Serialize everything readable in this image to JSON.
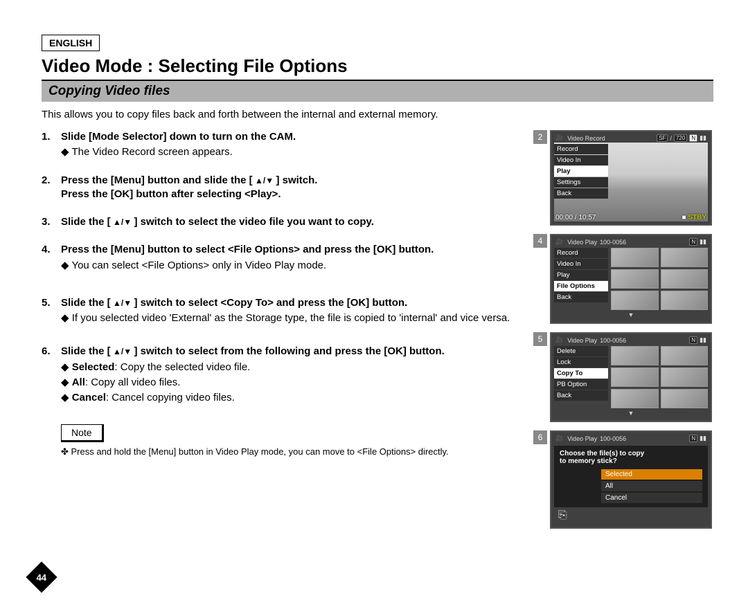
{
  "lang": "ENGLISH",
  "title": "Video Mode : Selecting File Options",
  "subtitle": "Copying Video files",
  "intro": "This allows you to copy files back and forth between the internal and external memory.",
  "steps": {
    "s1": {
      "num": "1.",
      "head": "Slide [Mode Selector] down to turn on the CAM.",
      "sub1": "The Video Record screen appears."
    },
    "s2": {
      "num": "2.",
      "head_a": "Press the [Menu] button and slide the [",
      "head_b": "] switch.",
      "head2": "Press the [OK] button after selecting <Play>."
    },
    "s3": {
      "num": "3.",
      "head_a": "Slide the [",
      "head_b": "] switch to select the video file you want to copy."
    },
    "s4": {
      "num": "4.",
      "head": "Press the [Menu] button to select <File Options> and press the [OK] button.",
      "sub1": "You can select <File Options> only in Video Play mode."
    },
    "s5": {
      "num": "5.",
      "head_a": "Slide the [",
      "head_b": "] switch to select <Copy To> and press the [OK] button.",
      "sub1": "If you selected video 'External' as the Storage type, the file is copied to 'internal' and vice versa."
    },
    "s6": {
      "num": "6.",
      "head_a": "Slide the [",
      "head_b": "] switch to select from the following and press the [OK] button.",
      "sub_sel_b": "Selected",
      "sub_sel": ": Copy the selected video file.",
      "sub_all_b": "All",
      "sub_all": ": Copy all video files.",
      "sub_can_b": "Cancel",
      "sub_can": ": Cancel copying video files."
    }
  },
  "note_label": "Note",
  "note_text": "Press and hold the [Menu] button in Video Play mode, you can move to <File Options> directly.",
  "page": "44",
  "shots": {
    "s2": {
      "num": "2",
      "title": "Video Record",
      "badges": {
        "sf": "SF",
        "res": "720",
        "n": "N"
      },
      "menu": [
        "Record",
        "Video In",
        "Play",
        "Settings",
        "Back"
      ],
      "sel_index": 2,
      "timer": "00:00 / 10:57",
      "stby": "STBY"
    },
    "s4": {
      "num": "4",
      "title": "Video Play",
      "code": "100-0056",
      "menu": [
        "Record",
        "Video In",
        "Play",
        "File Options",
        "Back"
      ],
      "sel_index": 3
    },
    "s5": {
      "num": "5",
      "title": "Video Play",
      "code": "100-0056",
      "menu": [
        "Delete",
        "Lock",
        "Copy To",
        "PB Option",
        "Back"
      ],
      "sel_index": 2
    },
    "s6": {
      "num": "6",
      "title": "Video Play",
      "code": "100-0056",
      "prompt1": "Choose the file(s) to copy",
      "prompt2": "to memory stick?",
      "options": [
        "Selected",
        "All",
        "Cancel"
      ],
      "sel_index": 0
    }
  }
}
